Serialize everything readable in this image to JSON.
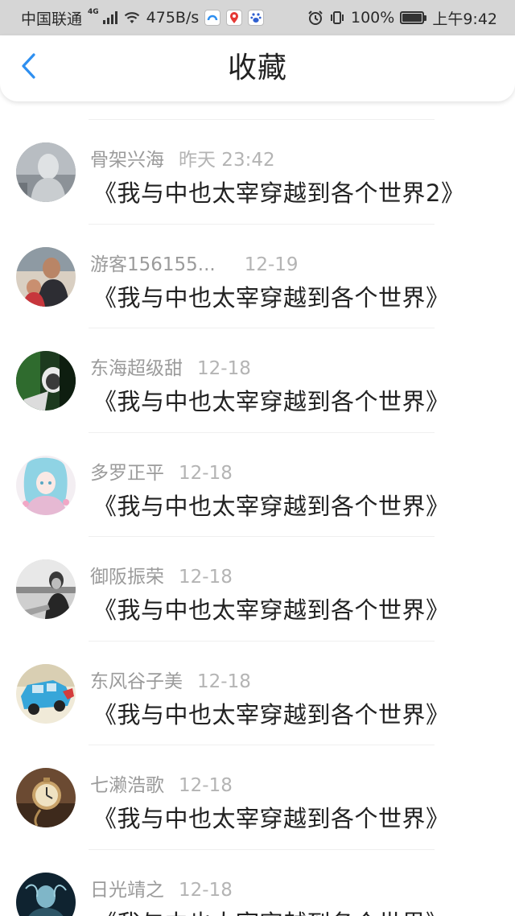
{
  "status_bar": {
    "carrier": "中国联通",
    "network": "4G",
    "speed": "475B/s",
    "battery": "100%",
    "time": "上午9:42",
    "battery_level": 1.0
  },
  "header": {
    "title": "收藏",
    "accent_color": "#2e8ff0"
  },
  "favorites": [
    {
      "user": "骨架兴海",
      "time": "昨天 23:42",
      "title": "《我与中也太宰穿越到各个世界2》"
    },
    {
      "user": "游客156155...",
      "time": "12-19",
      "title": "《我与中也太宰穿越到各个世界》"
    },
    {
      "user": "东海超级甜",
      "time": "12-18",
      "title": "《我与中也太宰穿越到各个世界》"
    },
    {
      "user": "多罗正平",
      "time": "12-18",
      "title": "《我与中也太宰穿越到各个世界》"
    },
    {
      "user": "御阪振荣",
      "time": "12-18",
      "title": "《我与中也太宰穿越到各个世界》"
    },
    {
      "user": "东风谷子美",
      "time": "12-18",
      "title": "《我与中也太宰穿越到各个世界》"
    },
    {
      "user": "七濑浩歌",
      "time": "12-18",
      "title": "《我与中也太宰穿越到各个世界》"
    },
    {
      "user": "日光靖之",
      "time": "12-18",
      "title": "《我与中也太宰穿越到各个世界》"
    }
  ]
}
